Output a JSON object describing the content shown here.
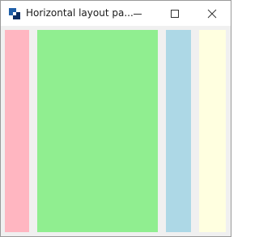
{
  "window": {
    "title": "Horizontal layout pa...",
    "controls": {
      "minimize": "minimize-icon",
      "maximize": "maximize-icon",
      "close": "close-icon"
    }
  },
  "panels": [
    {
      "name": "pink",
      "color": "#ffb6c1"
    },
    {
      "name": "lightgreen",
      "color": "#90ee90"
    },
    {
      "name": "lightblue",
      "color": "#add8e6"
    },
    {
      "name": "lightyellow",
      "color": "#ffffe0"
    }
  ]
}
